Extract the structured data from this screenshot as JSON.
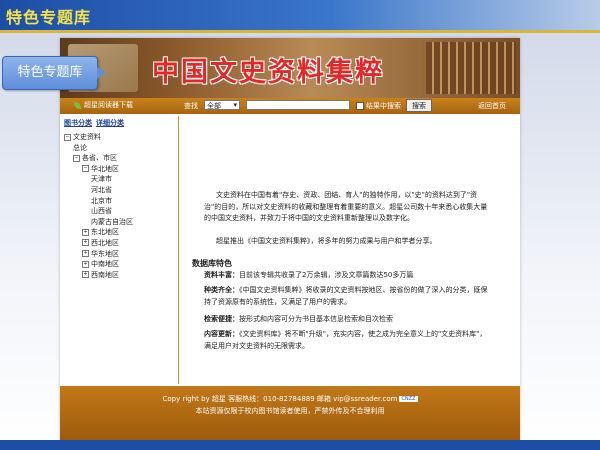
{
  "slide": {
    "title": "特色专题库"
  },
  "callout": {
    "label": "特色专题库"
  },
  "banner": {
    "title": "中国文史资料集粹"
  },
  "navbar": {
    "download_label": "超星阅读器下载",
    "search_label": "查找",
    "select_value": "全部",
    "checkbox_label": "结果中搜索",
    "search_button": "搜索",
    "home_link": "返回首页"
  },
  "left_panel": {
    "tabs": [
      "图书分类",
      "详细分类"
    ],
    "tree": [
      {
        "toggle": "⊟",
        "label": "文史资料",
        "level": 0
      },
      {
        "toggle": "",
        "label": "总论",
        "level": 1
      },
      {
        "toggle": "⊟",
        "label": "各省、市区",
        "level": 1
      },
      {
        "toggle": "⊟",
        "label": "华北地区",
        "level": 2
      },
      {
        "toggle": "",
        "label": "天津市",
        "level": 3
      },
      {
        "toggle": "",
        "label": "河北省",
        "level": 3
      },
      {
        "toggle": "",
        "label": "北京市",
        "level": 3
      },
      {
        "toggle": "",
        "label": "山西省",
        "level": 3
      },
      {
        "toggle": "",
        "label": "内蒙古自治区",
        "level": 3
      },
      {
        "toggle": "⊞",
        "label": "东北地区",
        "level": 2
      },
      {
        "toggle": "⊞",
        "label": "西北地区",
        "level": 2
      },
      {
        "toggle": "⊞",
        "label": "华东地区",
        "level": 2
      },
      {
        "toggle": "⊞",
        "label": "中南地区",
        "level": 2
      },
      {
        "toggle": "⊞",
        "label": "西南地区",
        "level": 2
      }
    ]
  },
  "main": {
    "intro_p1": "文史资料在中国有着\"存史、资政、团结、育人\"的独特作用，以\"史\"的资料达到了\"资治\"的目的，所以对文史资料的收藏和整理有着重要的意义。超星公司数十年来悉心收集大量的中国文史资料，并致力于将中国的文史资料重新整理以及数字化。",
    "intro_p2": "超星推出《中国文史资料集粹》，将多年的努力成果与用户和学者分享。",
    "features_heading": "数据库特色",
    "f1_label": "资料丰富：",
    "f1_text": "目前该专辑共收录了2万余辑，涉及文章篇数达50多万篇",
    "f2_label": "种类齐全：",
    "f2_text": "《中国文史资料集粹》将收录的文史资料按地区、按省份的做了深入的分类，既保持了资源原有的系统性，又满足了用户的需求。",
    "f3_label": "检索便捷：",
    "f3_text": "按形式和内容可分为书目基本信息检索和目次检索",
    "f4_label": "内容更新：",
    "f4_text": "《文史资料库》将不断\"升级\"，充实内容，使之成为完全意义上的\"文史资料库\"，满足用户对文史资料的无限需求。"
  },
  "footer": {
    "line1": "Copy right by 超星 客服热线：010-82784889 邮箱 vip@ssreader.com",
    "badge": "CNZZ",
    "line2": "本站资源仅限于校内图书馆读者使用，严禁外传及不合理利用"
  }
}
